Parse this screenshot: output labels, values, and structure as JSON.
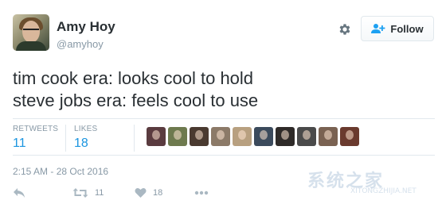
{
  "user": {
    "fullname": "Amy Hoy",
    "screenname": "@amyhoy"
  },
  "follow_label": "Follow",
  "tweet": {
    "line1": "tim cook era: looks cool to hold",
    "line2": "steve jobs era: feels cool to use"
  },
  "stats": {
    "retweets_label": "RETWEETS",
    "retweets_value": "11",
    "likes_label": "LIKES",
    "likes_value": "18"
  },
  "liker_avatars": [
    "#5a3b3f",
    "#6e7a4e",
    "#4a3a30",
    "#8c7a68",
    "#b8a080",
    "#3b4a5c",
    "#2e2a28",
    "#4a4a4a",
    "#7a6252",
    "#6a3a2e"
  ],
  "timestamp": "2:15 AM - 28 Oct 2016",
  "actions": {
    "retweet_count": "11",
    "like_count": "18"
  },
  "watermark": {
    "text": "系统之家",
    "sub": "XITONGZHIJIA.NET"
  },
  "colors": {
    "accent": "#1b95e0",
    "muted": "#8899a6",
    "icon": "#aab8c2"
  }
}
